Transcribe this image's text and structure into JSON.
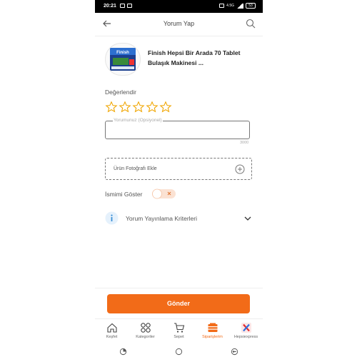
{
  "status_bar": {
    "time": "20:21",
    "network": "4.5G",
    "battery": "53"
  },
  "header": {
    "title": "Yorum Yap",
    "back_icon": "arrow-left-icon",
    "search_icon": "search-icon"
  },
  "product": {
    "name": "Finish Hepsi Bir Arada 70 Tablet Bulaşık Makinesi ...",
    "image_label": "Finish"
  },
  "rating": {
    "label": "Değerlendir",
    "max_stars": 5,
    "value": 0
  },
  "comment": {
    "placeholder": "Yorumunuz (Opsiyonel)",
    "counter": "3000"
  },
  "photo": {
    "label": "Ürün Fotoğrafı Ekle"
  },
  "name_toggle": {
    "label": "İsmimi Göster",
    "on": false
  },
  "criteria": {
    "label": "Yorum Yayınlama Kriterleri"
  },
  "submit": {
    "label": "Gönder"
  },
  "tabs": [
    {
      "label": "Keşfet",
      "icon": "home-icon",
      "active": false
    },
    {
      "label": "Kategoriler",
      "icon": "categories-icon",
      "active": false
    },
    {
      "label": "Sepet",
      "icon": "cart-icon",
      "active": false
    },
    {
      "label": "Siparişlerim",
      "icon": "orders-icon",
      "active": true
    },
    {
      "label": "Hepsiexpress",
      "icon": "hepsiexpress-icon",
      "active": false
    }
  ],
  "colors": {
    "accent": "#f26b18",
    "star": "#f0a500",
    "info": "#3b8fd6"
  }
}
